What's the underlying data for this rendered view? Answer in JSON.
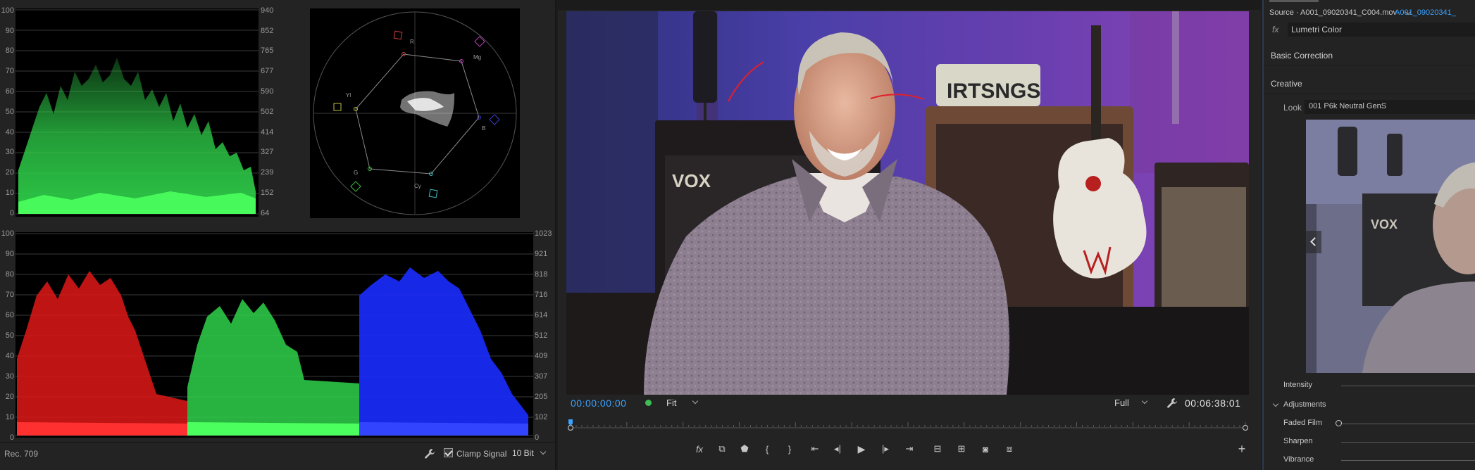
{
  "scopes": {
    "vectorscope_labels": [
      "R",
      "Mg",
      "B",
      "Cy",
      "G",
      "Yl"
    ],
    "waveform_axis_left": [
      "100",
      "90",
      "80",
      "70",
      "60",
      "50",
      "40",
      "30",
      "20",
      "10",
      "0"
    ],
    "waveform_axis_right": [
      "940",
      "852",
      "765",
      "677",
      "590",
      "502",
      "414",
      "327",
      "239",
      "152",
      "64"
    ],
    "parade_axis_left": [
      "100",
      "90",
      "80",
      "70",
      "60",
      "50",
      "40",
      "30",
      "20",
      "10",
      "0"
    ],
    "parade_axis_right": [
      "1023",
      "921",
      "818",
      "716",
      "614",
      "512",
      "409",
      "307",
      "205",
      "102",
      "0"
    ],
    "footer": {
      "color_space": "Rec. 709",
      "clamp_label": "Clamp Signal",
      "clamp_checked": true,
      "bit_depth": "10 Bit"
    },
    "colors": {
      "luma": "#2fd14a",
      "red": "#e01818",
      "green": "#2fd14a",
      "blue": "#1a2cff"
    }
  },
  "program": {
    "plate_text": "IRTSNGS",
    "amp_brand": "VOX",
    "current_timecode": "00:00:00:00",
    "duration_timecode": "00:06:38:01",
    "zoom": "Fit",
    "resolution": "Full",
    "playhead_fraction": 0,
    "transport": {
      "icons": [
        "fx-icon",
        "insert-overwrite-icon",
        "add-marker-icon",
        "mark-in-icon",
        "mark-out-icon",
        "go-to-in-icon",
        "step-back-icon",
        "play-icon",
        "step-forward-icon",
        "go-to-out-icon",
        "lift-icon",
        "extract-icon",
        "export-frame-icon",
        "comparison-view-icon",
        "add-button-icon"
      ]
    }
  },
  "lumetri": {
    "source_label": "Source · A001_09020341_C004.mov",
    "clip_link": "A001_09020341_",
    "effect_name": "Lumetri Color",
    "fx_label": "fx",
    "basic_correction": "Basic Correction",
    "creative": "Creative",
    "look_label": "Look",
    "look_value": "001 P6k Neutral GenS",
    "intensity_label": "Intensity",
    "adjustments_label": "Adjustments",
    "faded_film_label": "Faded Film",
    "faded_film_value": 0,
    "sharpen_label": "Sharpen",
    "vibrance_label": "Vibrance",
    "accent": "#3aa2ff"
  }
}
